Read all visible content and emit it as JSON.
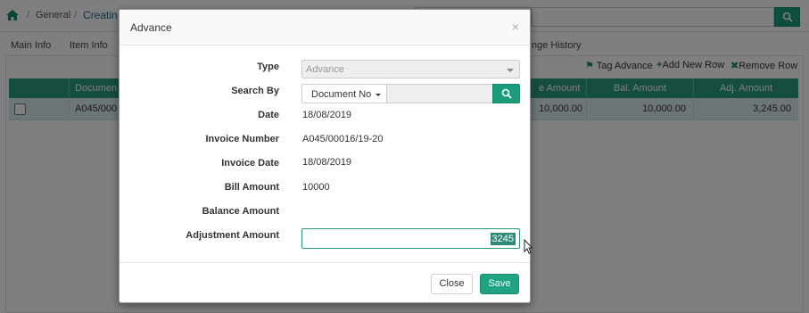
{
  "breadcrumb": {
    "item1": "General",
    "current": "Creatin"
  },
  "tabs": [
    "Main Info",
    "Item Info",
    "nge History"
  ],
  "toolbar": {
    "tag_advance": "Tag Advance",
    "add_row": "Add New Row",
    "remove_row": "Remove Row"
  },
  "grid": {
    "headers": [
      "Documen",
      "e Amount",
      "Bal. Amount",
      "Adj. Amount"
    ],
    "row": {
      "document": "A045/000",
      "amount": "10,000.00",
      "balance": "10,000.00",
      "adjusted": "3,245.00"
    }
  },
  "modal": {
    "title": "Advance",
    "close_glyph": "×",
    "fields": {
      "type_label": "Type",
      "type_value": "Advance",
      "search_by_label": "Search By",
      "search_by_option": "Document No",
      "date_label": "Date",
      "date_value": "18/08/2019",
      "invoice_number_label": "Invoice Number",
      "invoice_number_value": "A045/00016/19-20",
      "invoice_date_label": "Invoice Date",
      "invoice_date_value": "18/08/2019",
      "bill_amount_label": "Bill Amount",
      "bill_amount_value": "10000",
      "balance_amount_label": "Balance Amount",
      "adjustment_amount_label": "Adjustment Amount",
      "adjustment_amount_value": "3245"
    },
    "buttons": {
      "close": "Close",
      "save": "Save"
    }
  },
  "colors": {
    "accent": "#1a9c7a",
    "header_bg": "#2a9a7f"
  }
}
